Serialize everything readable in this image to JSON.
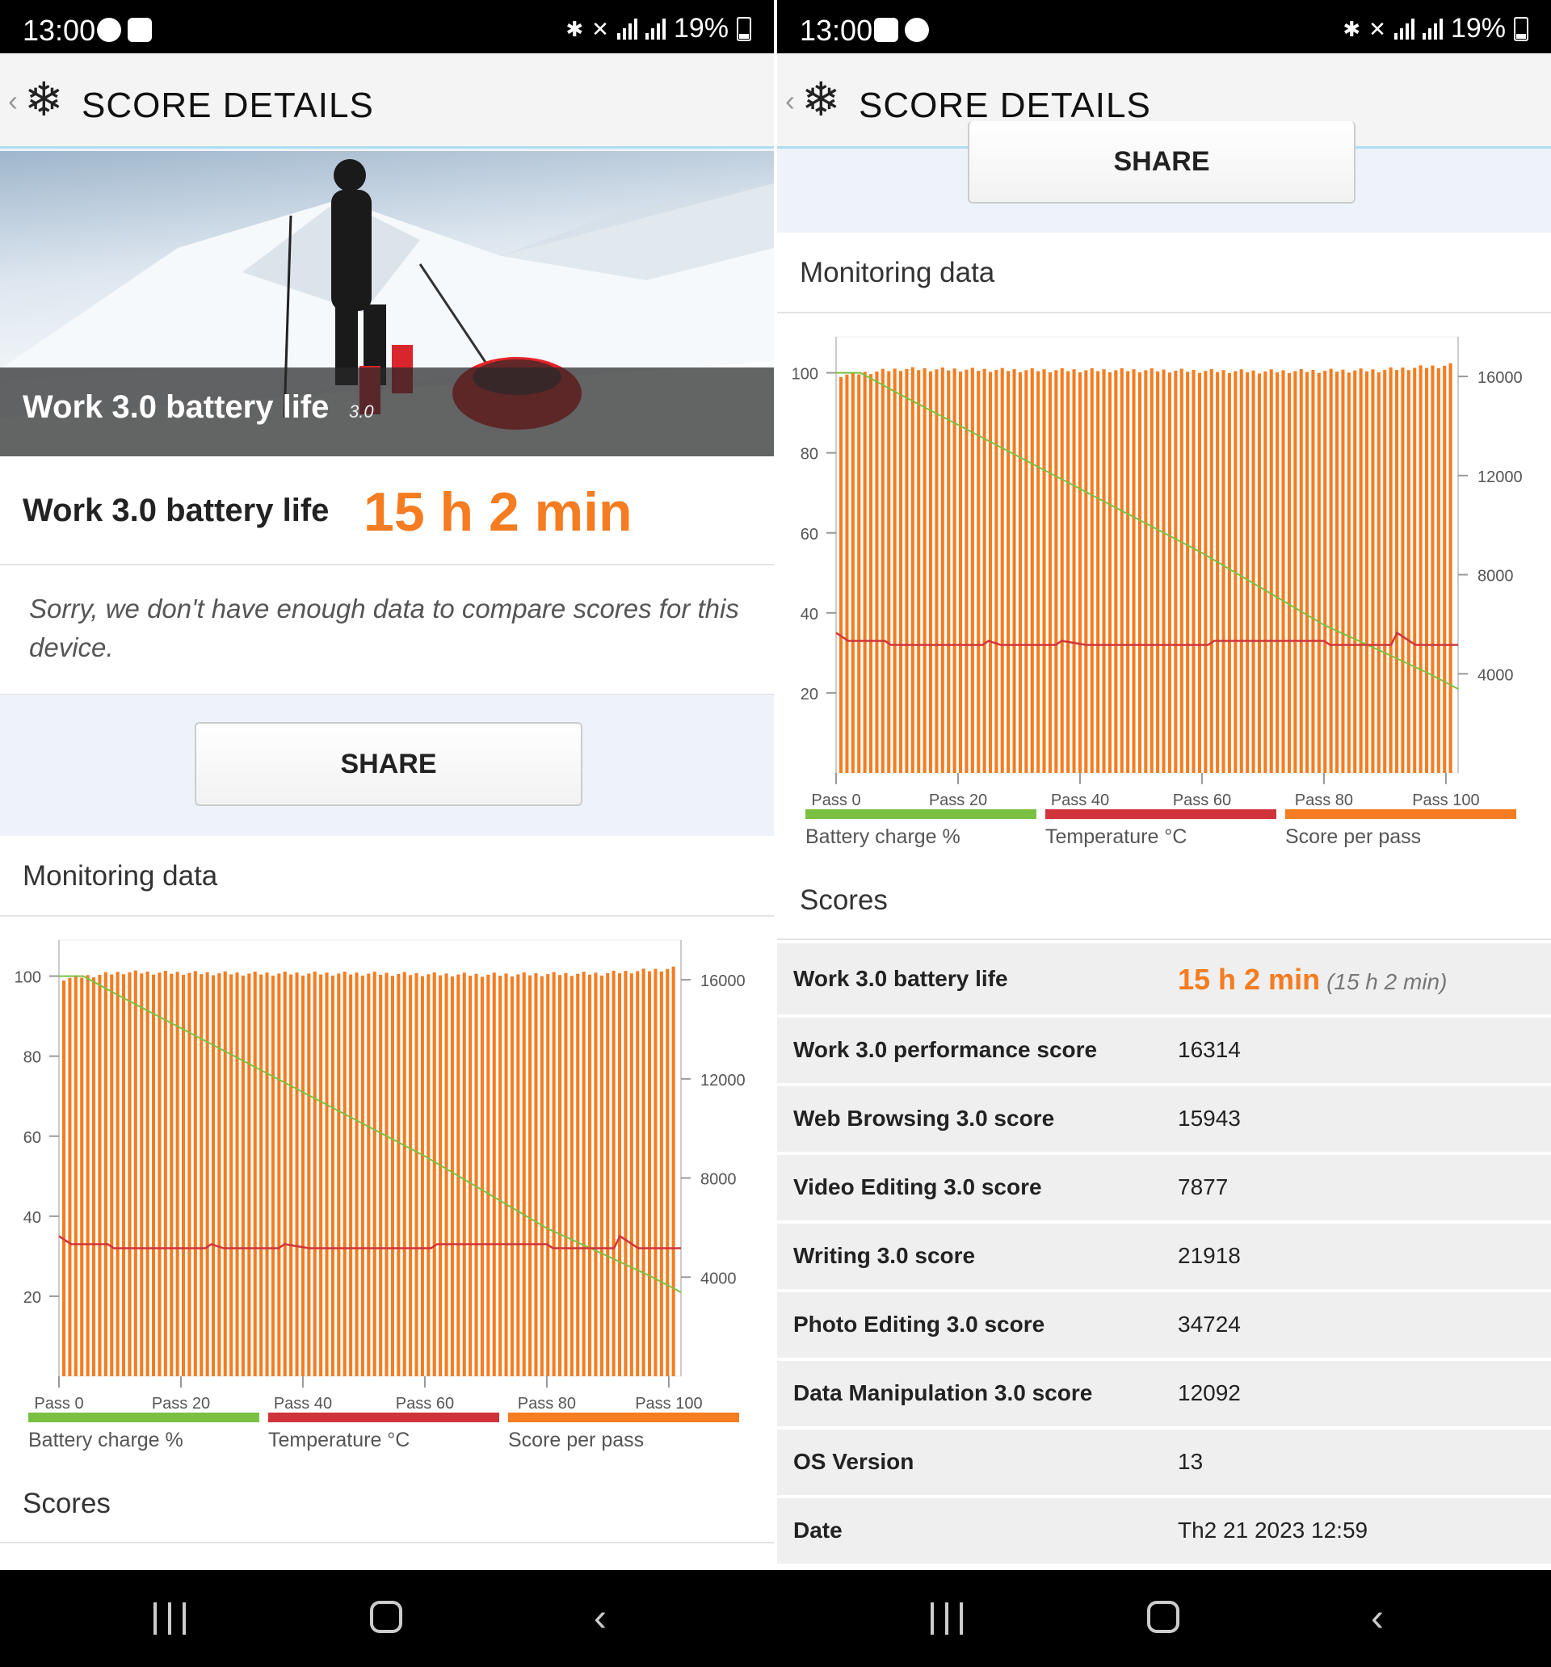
{
  "status": {
    "time": "13:00",
    "battery": "19%"
  },
  "header": {
    "title": "SCORE DETAILS"
  },
  "hero": {
    "title": "Work 3.0 battery life",
    "version": "3.0"
  },
  "result": {
    "label": "Work 3.0 battery life",
    "value": "15 h 2 min"
  },
  "compare_note": "Sorry, we don't have enough data to compare scores for this device.",
  "share_label": "SHARE",
  "monitoring": {
    "title": "Monitoring data",
    "legend": [
      {
        "label": "Battery charge %",
        "color": "#7ac143"
      },
      {
        "label": "Temperature °C",
        "color": "#d0343a"
      },
      {
        "label": "Score per pass",
        "color": "#f57c20"
      }
    ]
  },
  "scores": {
    "title": "Scores",
    "rows": [
      {
        "name": "Work 3.0 battery life",
        "value": "15 h 2 min",
        "sub": "(15 h 2 min)"
      },
      {
        "name": "Work 3.0 performance score",
        "value": "16314"
      },
      {
        "name": "Web Browsing 3.0 score",
        "value": "15943"
      },
      {
        "name": "Video Editing 3.0 score",
        "value": "7877"
      },
      {
        "name": "Writing 3.0 score",
        "value": "21918"
      },
      {
        "name": "Photo Editing 3.0 score",
        "value": "34724"
      },
      {
        "name": "Data Manipulation 3.0 score",
        "value": "12092"
      },
      {
        "name": "OS Version",
        "value": "13"
      },
      {
        "name": "Date",
        "value": "Th2 21 2023 12:59"
      }
    ]
  },
  "chart_data": {
    "type": "bar",
    "x_tick_labels": [
      "Pass 0",
      "Pass 20",
      "Pass 40",
      "Pass 60",
      "Pass 80",
      "Pass 100"
    ],
    "x_range": [
      0,
      102
    ],
    "y_left_ticks": [
      20,
      40,
      60,
      80,
      100
    ],
    "y_left_range": [
      0,
      109
    ],
    "y_right_ticks": [
      4000,
      8000,
      12000,
      16000
    ],
    "y_right_range": [
      0,
      17600
    ],
    "series": [
      {
        "name": "Score per pass",
        "axis": "right",
        "style": "bars",
        "points": [
          [
            0,
            16050
          ],
          [
            10,
            16300
          ],
          [
            30,
            16250
          ],
          [
            50,
            16250
          ],
          [
            70,
            16200
          ],
          [
            90,
            16250
          ],
          [
            102,
            16450
          ]
        ]
      },
      {
        "name": "Battery charge %",
        "axis": "left",
        "style": "line",
        "points": [
          [
            0,
            100
          ],
          [
            4,
            100
          ],
          [
            10,
            95
          ],
          [
            20,
            87
          ],
          [
            30,
            79
          ],
          [
            40,
            71
          ],
          [
            50,
            63
          ],
          [
            60,
            55
          ],
          [
            70,
            46
          ],
          [
            80,
            37
          ],
          [
            90,
            30
          ],
          [
            97,
            25
          ],
          [
            102,
            21
          ]
        ]
      },
      {
        "name": "Temperature °C",
        "axis": "left",
        "style": "line",
        "points": [
          [
            0,
            35
          ],
          [
            2,
            33
          ],
          [
            8,
            33
          ],
          [
            9,
            32
          ],
          [
            24,
            32
          ],
          [
            25,
            33
          ],
          [
            27,
            32
          ],
          [
            36,
            32
          ],
          [
            37,
            33
          ],
          [
            41,
            32
          ],
          [
            61,
            32
          ],
          [
            62,
            33
          ],
          [
            80,
            33
          ],
          [
            81,
            32
          ],
          [
            91,
            32
          ],
          [
            92,
            35
          ],
          [
            95,
            32
          ],
          [
            102,
            32
          ]
        ]
      }
    ]
  }
}
